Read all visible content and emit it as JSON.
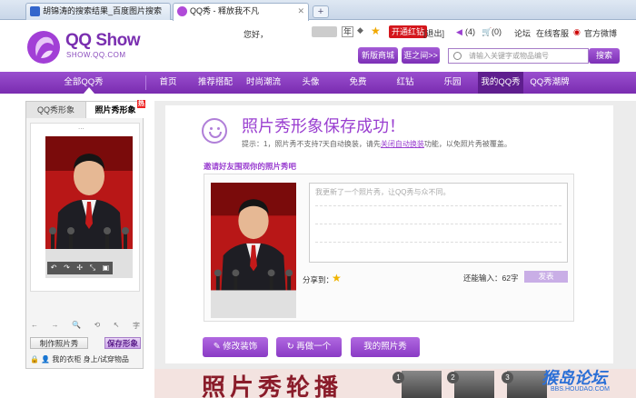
{
  "browser": {
    "tabs": [
      {
        "label": "胡锦涛的搜索结果_百度图片搜索"
      },
      {
        "label": "QQ秀 - 释放我不凡"
      }
    ],
    "new_tab": "+"
  },
  "header": {
    "logo_text": "QQ Show",
    "logo_sub": "SHOW.QQ.COM",
    "greeting": "您好，",
    "level": "年",
    "kaitong": "开通红钻",
    "logout": "[退出]",
    "count1": "(4)",
    "count2": "(0)",
    "forum": "论坛",
    "service": "在线客服",
    "weibo": "官方微博",
    "new_mall": "新版商城>>",
    "stroll": "逛之间>>",
    "search_placeholder": "请输入关键字或物品编号",
    "search_btn": "搜索"
  },
  "nav": {
    "items": [
      "全部QQ秀",
      "首页",
      "推荐搭配",
      "时尚潮流",
      "头像",
      "免费",
      "红钻",
      "乐园",
      "我的QQ秀",
      "QQ秀潮牌"
    ]
  },
  "left": {
    "tab1": "QQ秀形象",
    "tab2": "照片秀形象",
    "hot": "热",
    "dots": "...",
    "tools": [
      "↶",
      "↷",
      "✢",
      "⤡",
      "▣"
    ],
    "toolrow": [
      "←",
      "→",
      "🔍",
      "⟲",
      "↖",
      "字"
    ],
    "make_btn": "制作照片秀",
    "save_btn": "保存形象",
    "bottom": "我的衣柜  身上/试穿物品"
  },
  "main": {
    "title": "照片秀形象保存成功！",
    "tip_prefix": "提示：1，照片秀不支持7天自动换装，请先",
    "tip_link": "关闭自动换装",
    "tip_suffix": "功能，以免照片秀被覆盖。",
    "invite": "邀请好友围观你的照片秀吧",
    "textarea_placeholder": "我更新了一个照片秀，让QQ秀与众不同。",
    "share_to": "分享到：",
    "remain": "还能输入：62字",
    "send": "发表",
    "btn_dress": "修改装饰",
    "btn_redo": "再做一个",
    "btn_mine": "我的照片秀"
  },
  "banner": {
    "text": "照片秀轮播",
    "nums": [
      "1",
      "2",
      "3"
    ]
  },
  "watermark": {
    "text": "猴岛论坛",
    "sub": "BBS.HOUDAO.COM"
  },
  "colors": {
    "brand": "#7a2cb0",
    "accent": "#9a3fd0",
    "red": "#d4161c"
  }
}
